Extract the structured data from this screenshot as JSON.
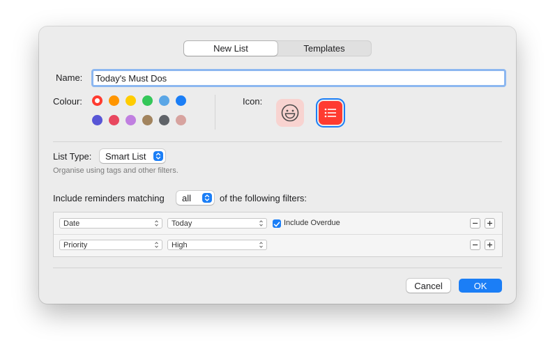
{
  "tabs": [
    {
      "label": "New List",
      "active": true
    },
    {
      "label": "Templates",
      "active": false
    }
  ],
  "name": {
    "label": "Name:",
    "value": "Today's Must Dos"
  },
  "colour": {
    "label": "Colour:",
    "swatches": [
      "#ff3b30",
      "#ff9500",
      "#ffcc00",
      "#34c759",
      "#5aa6e6",
      "#1b7ef6",
      "#5856d6",
      "#e8475f",
      "#c07fe0",
      "#a2845e",
      "#5f6368",
      "#d7a39f"
    ],
    "selected": "#ff3b30"
  },
  "icon": {
    "label": "Icon:",
    "options": [
      "smiley-icon",
      "list-icon"
    ],
    "selected": "list-icon"
  },
  "list_type": {
    "label": "List Type:",
    "value": "Smart List",
    "hint": "Organise using tags and other filters."
  },
  "match": {
    "prefix": "Include reminders matching",
    "value": "all",
    "suffix": "of the following filters:"
  },
  "filters": [
    {
      "field": "Date",
      "value": "Today",
      "include_overdue": {
        "label": "Include Overdue",
        "checked": true
      }
    },
    {
      "field": "Priority",
      "value": "High"
    }
  ],
  "buttons": {
    "cancel": "Cancel",
    "ok": "OK"
  },
  "accent_color": "#1b7ef6"
}
